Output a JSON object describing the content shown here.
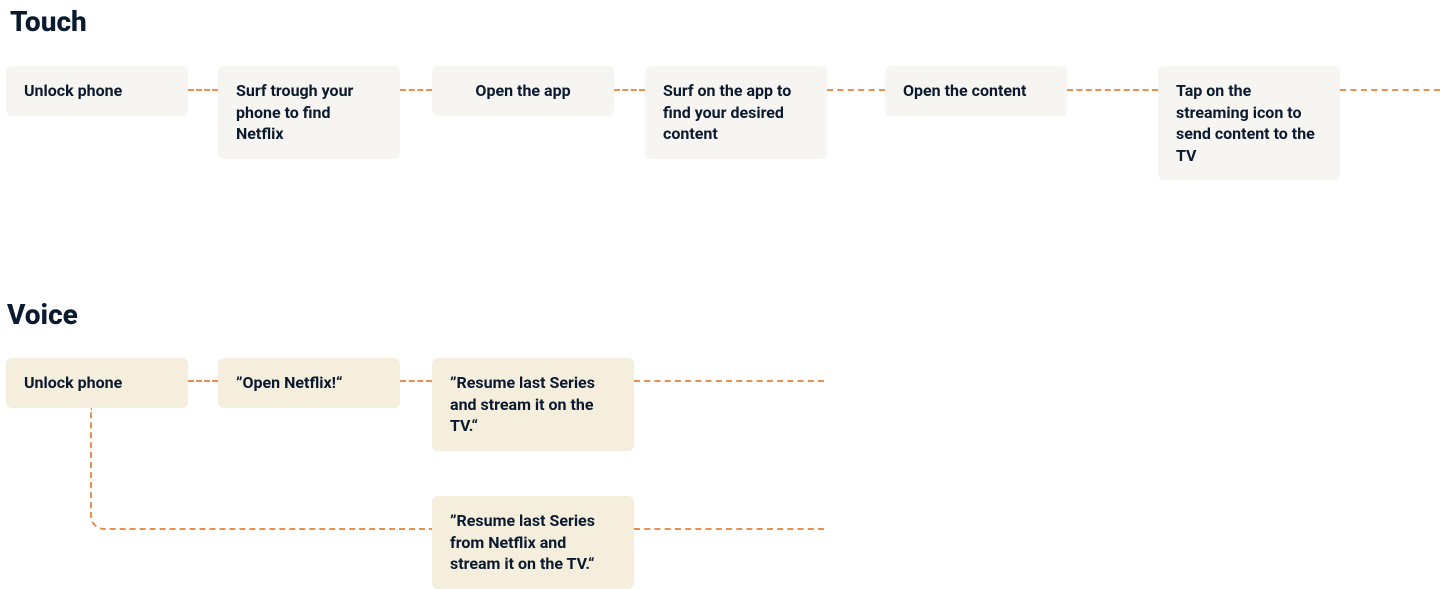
{
  "sections": {
    "touch": {
      "title": "Touch",
      "steps": [
        "Unlock phone",
        "Surf trough your phone to find Netflix",
        "Open the app",
        "Surf on the app to find your desired content",
        "Open the content",
        "Tap on the streaming icon to send content to the TV"
      ]
    },
    "voice": {
      "title": "Voice",
      "steps": [
        "Unlock phone",
        "”Open Netflix!“",
        "”Resume last Series and stream it on the TV.“"
      ],
      "alt_step": "”Resume last Series from Netflix and stream it on the TV.“"
    }
  },
  "colors": {
    "title": "#0a1a2f",
    "touch_box_bg": "#f7f5f2",
    "voice_box_bg": "#f5eedc",
    "connector": "#e8833a"
  }
}
